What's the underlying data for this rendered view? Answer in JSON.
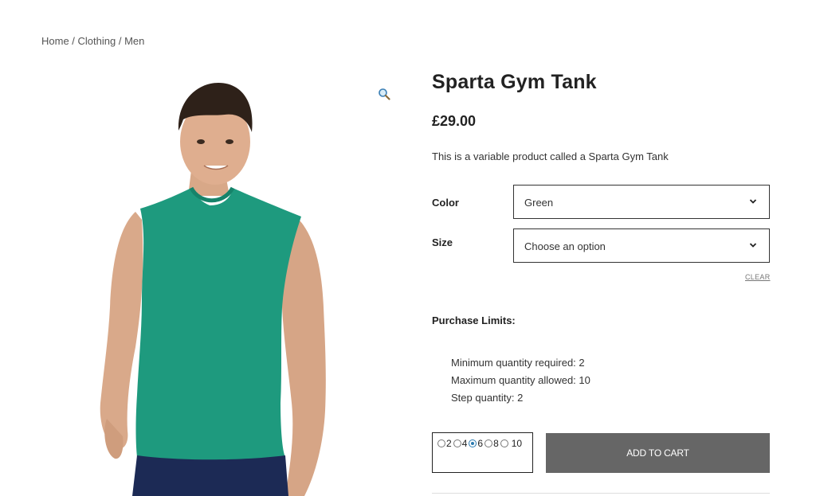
{
  "breadcrumb": {
    "home": "Home",
    "sep1": " / ",
    "category": "Clothing",
    "sep2": " / ",
    "subcategory": "Men"
  },
  "gallery": {
    "zoom_icon": "magnifier-icon",
    "image_alt": "Model wearing green sleeveless gym tank",
    "shirt_color": "#1e9a7e",
    "shorts_color": "#1c2a55"
  },
  "product": {
    "title": "Sparta Gym Tank",
    "price": "£29.00",
    "description": "This is a variable product called a Sparta Gym Tank"
  },
  "variations": {
    "color": {
      "label": "Color",
      "value": "Green"
    },
    "size": {
      "label": "Size",
      "value": "Choose an option"
    },
    "clear": "CLEAR"
  },
  "limits": {
    "title": "Purchase Limits:",
    "min": "Minimum quantity required: 2",
    "max": "Maximum quantity allowed: 10",
    "step": "Step quantity: 2"
  },
  "quantity": {
    "options": [
      "2",
      "4",
      "6",
      "8",
      "10"
    ],
    "selected": "6"
  },
  "cart": {
    "add_label": "ADD TO CART",
    "button_color": "#666666"
  }
}
